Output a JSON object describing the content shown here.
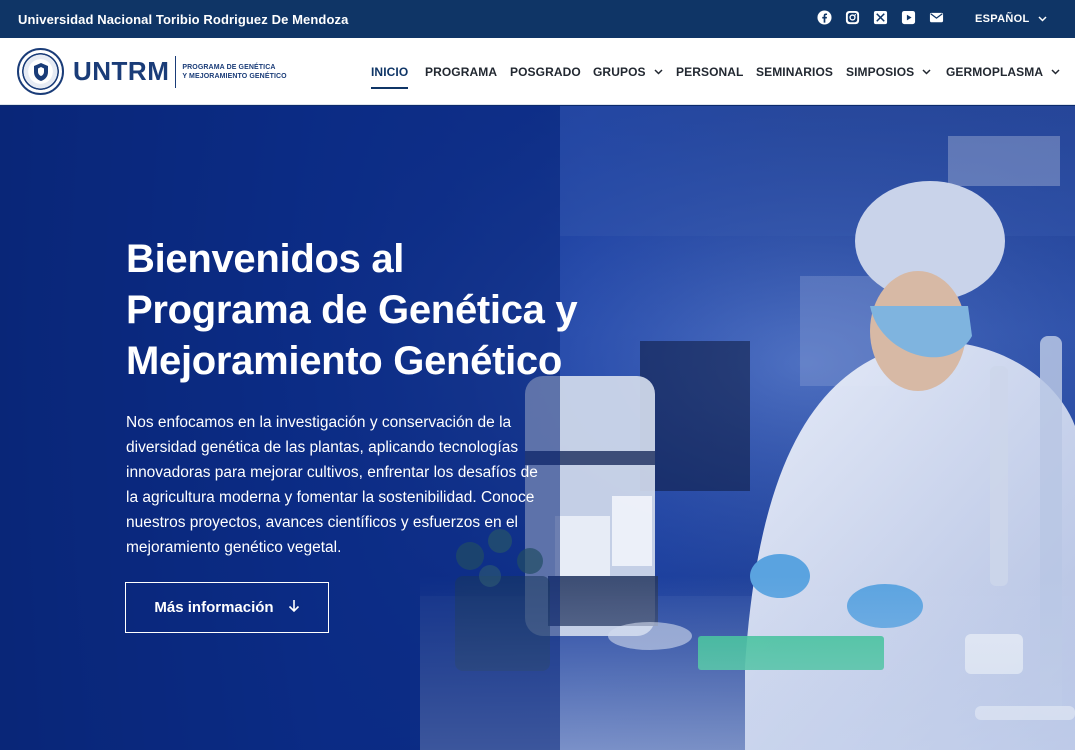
{
  "topbar": {
    "university": "Universidad Nacional Toribio Rodriguez De Mendoza",
    "social": [
      "facebook-icon",
      "instagram-icon",
      "x-icon",
      "youtube-icon",
      "mail-icon"
    ],
    "language": "ESPAÑOL"
  },
  "logo": {
    "wordmark": "UNTRM",
    "subtitle_line1": "PROGRAMA DE GENÉTICA",
    "subtitle_line2": "Y MEJORAMIENTO GENÉTICO"
  },
  "nav": {
    "items": [
      {
        "label": "INICIO",
        "active": true
      },
      {
        "label": "PROGRAMA"
      },
      {
        "label": "POSGRADO"
      },
      {
        "label": "GRUPOS",
        "dropdown": true
      },
      {
        "label": "PERSONAL"
      },
      {
        "label": "SEMINARIOS"
      },
      {
        "label": "SIMPOSIOS",
        "dropdown": true
      },
      {
        "label": "GERMOPLASMA",
        "dropdown": true
      }
    ]
  },
  "hero": {
    "title_line1": "Bienvenidos al",
    "title_line2": "Programa de Genética y",
    "title_line3": "Mejoramiento Genético",
    "description": "Nos enfocamos en la investigación y conservación de la diversidad genética de las plantas, aplicando tecnologías innovadoras para mejorar cultivos, enfrentar los desafíos de la agricultura moderna y fomentar la sostenibilidad. Conoce nuestros proyectos, avances científicos y esfuerzos en el mejoramiento genético vegetal.",
    "cta_label": "Más información",
    "cta_icon": "arrow-down-icon"
  },
  "colors": {
    "topbar": "#0f3566",
    "brand": "#1a3c78",
    "hero_overlay": "#0a2678"
  }
}
